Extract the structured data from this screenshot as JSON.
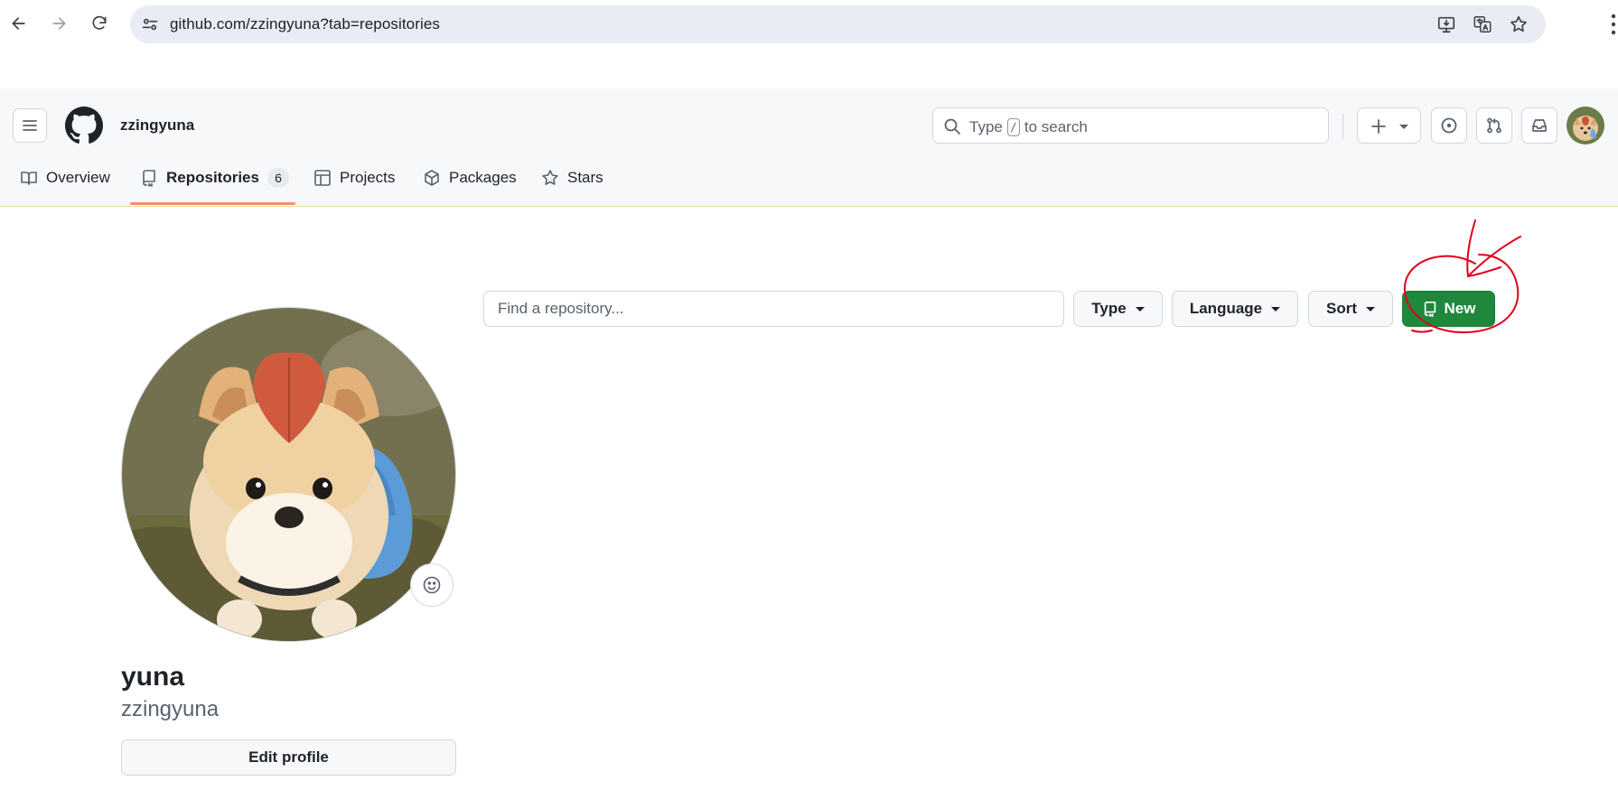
{
  "browser": {
    "url": "github.com/zzingyuna?tab=repositories"
  },
  "header": {
    "username": "zzingyuna",
    "search": {
      "prefix": "Type",
      "shortcut": "/",
      "suffix": "to search"
    }
  },
  "tabs": [
    {
      "label": "Overview",
      "icon": "book-icon"
    },
    {
      "label": "Repositories",
      "icon": "repo-icon",
      "count": "6"
    },
    {
      "label": "Projects",
      "icon": "table-icon"
    },
    {
      "label": "Packages",
      "icon": "package-icon"
    },
    {
      "label": "Stars",
      "icon": "star-icon"
    }
  ],
  "active_tab": "Repositories",
  "profile": {
    "name": "yuna",
    "login": "zzingyuna",
    "edit_label": "Edit profile"
  },
  "repo_filters": {
    "find_placeholder": "Find a repository...",
    "type_label": "Type",
    "language_label": "Language",
    "sort_label": "Sort",
    "new_label": "New"
  },
  "colors": {
    "primary_button": "#1f883d",
    "tab_underline": "#fd8c73",
    "annotation": "#e0001b"
  }
}
